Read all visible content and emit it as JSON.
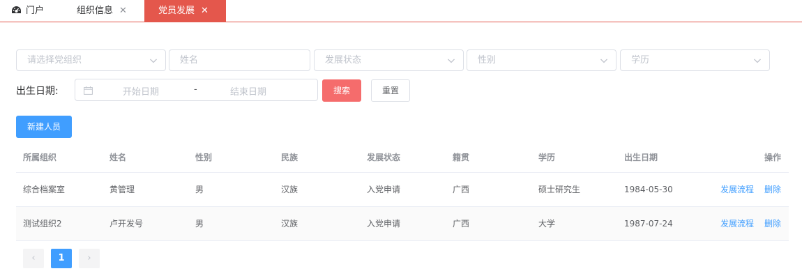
{
  "tabs": [
    {
      "label": "门户",
      "active": false,
      "closable": false,
      "icon": "dashboard-icon"
    },
    {
      "label": "组织信息",
      "active": false,
      "closable": true
    },
    {
      "label": "党员发展",
      "active": true,
      "closable": true
    }
  ],
  "filters": {
    "org_placeholder": "请选择党组织",
    "name_placeholder": "姓名",
    "status_placeholder": "发展状态",
    "gender_placeholder": "性别",
    "education_placeholder": "学历",
    "birth_label": "出生日期:",
    "start_placeholder": "开始日期",
    "range_separator": "-",
    "end_placeholder": "结束日期",
    "search_label": "搜索",
    "reset_label": "重置"
  },
  "new_button_label": "新建人员",
  "table": {
    "headers": [
      "所属组织",
      "姓名",
      "性别",
      "民族",
      "发展状态",
      "籍贯",
      "学历",
      "出生日期",
      "操作"
    ],
    "rows": [
      [
        "综合档案室",
        "黄管理",
        "男",
        "汉族",
        "入党申请",
        "广西",
        "硕士研究生",
        "1984-05-30"
      ],
      [
        "测试组织2",
        "卢开发号",
        "男",
        "汉族",
        "入党申请",
        "广西",
        "大学",
        "1987-07-24"
      ]
    ],
    "actions": [
      "发展流程",
      "删除"
    ]
  },
  "pagination": {
    "prev": "‹",
    "current": "1",
    "next": "›"
  },
  "colors": {
    "accent": "#e4574c",
    "primary": "#409eff",
    "danger": "#f56c6c"
  }
}
